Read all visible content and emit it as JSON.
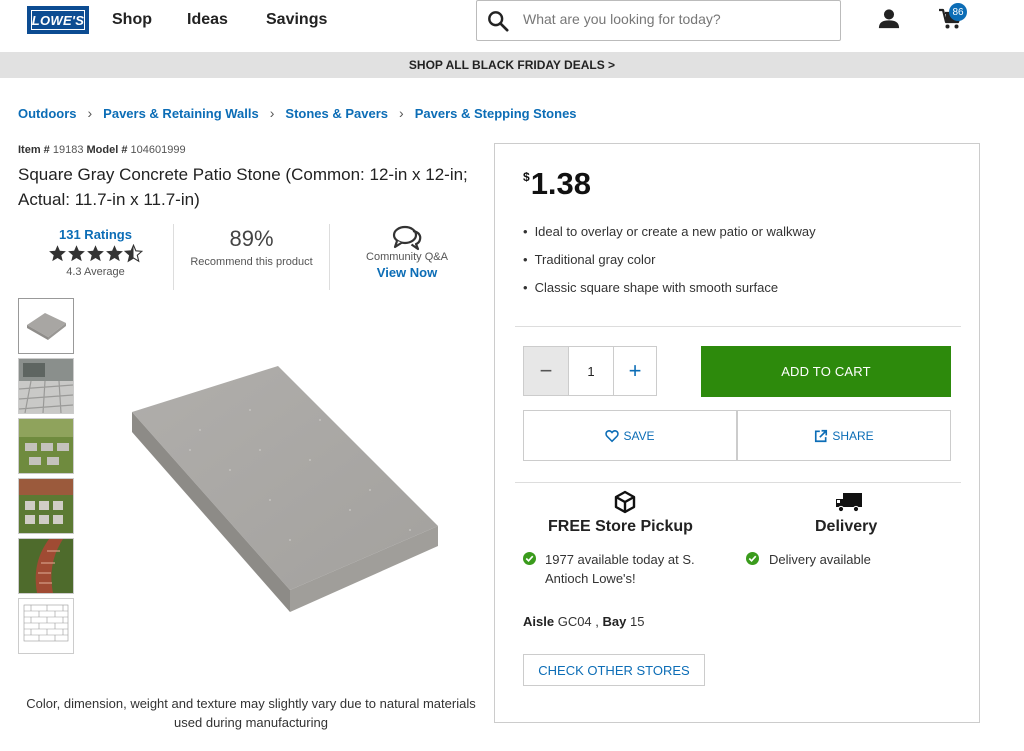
{
  "header": {
    "logo_text": "LOWE'S",
    "nav": [
      "Shop",
      "Ideas",
      "Savings"
    ],
    "search_placeholder": "What are you looking for today?",
    "cart_count": "86"
  },
  "promo": {
    "text": "SHOP ALL BLACK FRIDAY DEALS >"
  },
  "breadcrumb": [
    "Outdoors",
    "Pavers & Retaining Walls",
    "Stones & Pavers",
    "Pavers & Stepping Stones"
  ],
  "product": {
    "item_label": "Item #",
    "item_number": "19183",
    "model_label": "Model #",
    "model_number": "104601999",
    "title": "Square Gray Concrete Patio Stone (Common: 12-in x 12-in; Actual: 11.7-in x 11.7-in)",
    "ratings_count": "131 Ratings",
    "rating_value": 4.3,
    "rating_average": "4.3 Average",
    "recommend_pct": "89%",
    "recommend_label": "Recommend this product",
    "qa_label": "Community Q&A",
    "qa_link": "View Now",
    "disclaimer": "Color, dimension, weight and texture may slightly vary due to natural materials used during manufacturing"
  },
  "purchase": {
    "currency": "$",
    "price": "1.38",
    "bullets": [
      "Ideal to overlay or create a new patio or walkway",
      "Traditional gray color",
      "Classic square shape with smooth surface"
    ],
    "quantity": "1",
    "add_to_cart": "ADD TO CART",
    "save": "SAVE",
    "share": "SHARE"
  },
  "fulfillment": {
    "pickup_title": "FREE Store Pickup",
    "pickup_status": "1977 available today at S. Antioch Lowe's!",
    "delivery_title": "Delivery",
    "delivery_status": "Delivery available",
    "aisle_label": "Aisle",
    "aisle": "GC04",
    "bay_label": "Bay",
    "bay": "15",
    "check_stores": "CHECK OTHER STORES"
  },
  "colors": {
    "brand_blue": "#0c4c92",
    "link_blue": "#0c6db6",
    "cart_green": "#2d8a0c",
    "check_green": "#3a9b1c"
  }
}
